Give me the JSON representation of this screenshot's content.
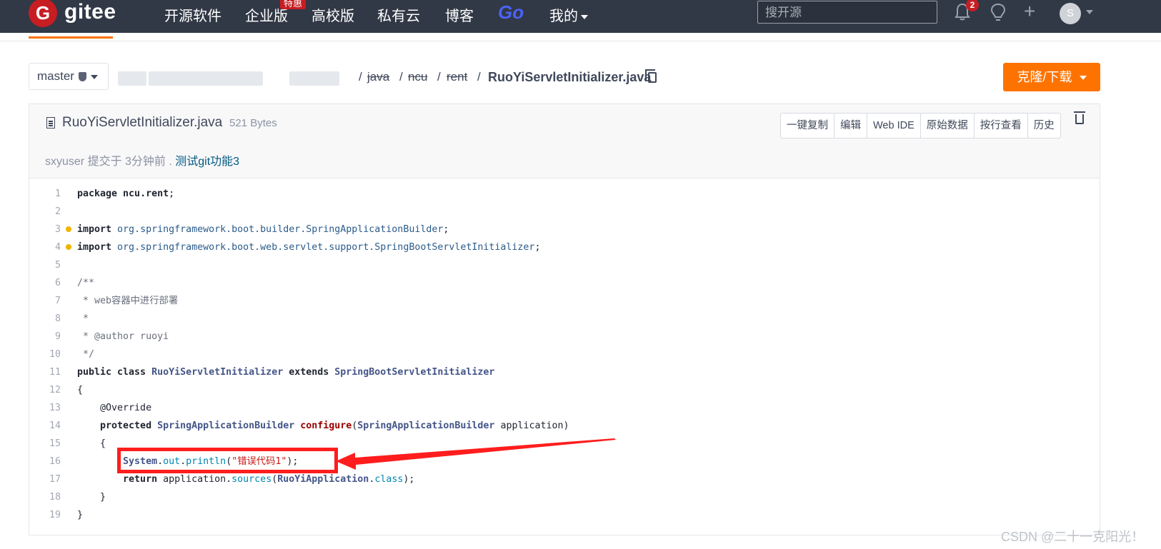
{
  "navbar": {
    "logo_letter": "G",
    "logo_text": "gitee",
    "items": [
      "开源软件",
      "企业版",
      "高校版",
      "私有云",
      "博客"
    ],
    "enterprise_badge": "特惠",
    "go_label": "Go",
    "mine_label": "我的",
    "search_placeholder": "搜开源",
    "notification_count": "2",
    "avatar_letter": "S"
  },
  "repo": {
    "branch": "master",
    "breadcrumb": [
      "java",
      "ncu",
      "rent"
    ],
    "file_name": "RuoYiServletInitializer.java",
    "clone_button": "克隆/下载"
  },
  "file": {
    "title": "RuoYiServletInitializer.java",
    "size": "521 Bytes",
    "actions": [
      "一键复制",
      "编辑",
      "Web IDE",
      "原始数据",
      "按行查看",
      "历史"
    ],
    "commit_author": "sxyuser",
    "commit_text": "提交于 3分钟前 .",
    "commit_message": "测试git功能3"
  },
  "code_lines": [
    "1",
    "2",
    "3",
    "4",
    "5",
    "6",
    "7",
    "8",
    "9",
    "10",
    "11",
    "12",
    "13",
    "14",
    "15",
    "16",
    "17",
    "18",
    "19"
  ],
  "code": {
    "l1a": "package ",
    "l1b": "ncu.rent",
    "l1c": ";",
    "l3a": "import ",
    "l3b": "org.springframework.boot.builder.SpringApplicationBuilder",
    "l3c": ";",
    "l4a": "import ",
    "l4b": "org.springframework.boot.web.servlet.support.SpringBootServletInitializer",
    "l4c": ";",
    "l6": "/**",
    "l7": " * web容器中进行部署",
    "l8": " *",
    "l9": " * @author ruoyi",
    "l10": " */",
    "l11a": "public class ",
    "l11b": "RuoYiServletInitializer",
    "l11c": " extends ",
    "l11d": "SpringBootServletInitializer",
    "l12": "{",
    "l13": "    @Override",
    "l14a": "    protected ",
    "l14b": "SpringApplicationBuilder",
    "l14c": " configure",
    "l14d": "(",
    "l14e": "SpringApplicationBuilder",
    "l14f": " application)",
    "l15": "    {",
    "l16a": "        System",
    "l16b": ".",
    "l16c": "out",
    "l16d": ".",
    "l16e": "println",
    "l16f": "(",
    "l16g": "\"错误代码1\"",
    "l16h": ");",
    "l17a": "        return",
    "l17b": " application.",
    "l17c": "sources",
    "l17d": "(",
    "l17e": "RuoYiApplication",
    "l17f": ".",
    "l17g": "class",
    "l17h": ");",
    "l18": "    }",
    "l19": "}"
  },
  "watermark": "CSDN @二十一克阳光！",
  "colors": {
    "brand": "#c71d23",
    "accent": "#fe7300",
    "annotation": "#ff1d1d"
  }
}
